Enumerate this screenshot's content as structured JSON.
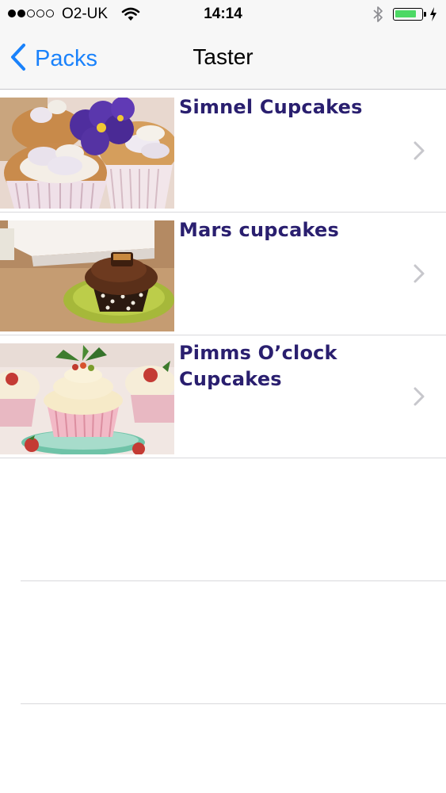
{
  "status_bar": {
    "carrier": "O2-UK",
    "time": "14:14",
    "signal_bars_filled": 2,
    "signal_bars_total": 5,
    "battery_level": 0.85,
    "battery_color": "#4cd964",
    "icons": [
      "wifi-icon",
      "bluetooth-icon",
      "battery-icon",
      "charging-icon"
    ]
  },
  "nav": {
    "back_label": "Packs",
    "title": "Taster",
    "accent_color": "#1a82fb"
  },
  "recipes": [
    {
      "title": "Simnel Cupcakes"
    },
    {
      "title": "Mars cupcakes"
    },
    {
      "title": "Pimms O’clock Cupcakes"
    }
  ],
  "colors": {
    "title_text": "#2a1f6f"
  }
}
